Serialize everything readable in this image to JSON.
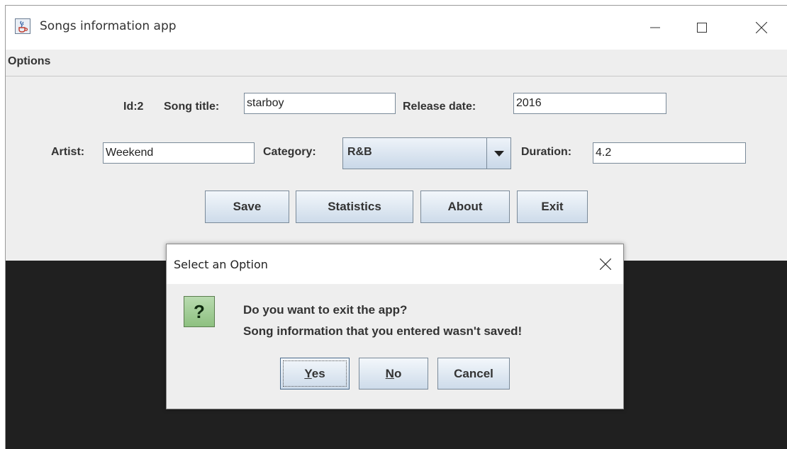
{
  "window": {
    "title": "Songs information app",
    "icon": "java-cup-icon",
    "controls": [
      "minimize-icon",
      "maximize-icon",
      "close-icon"
    ]
  },
  "menu": {
    "options_label": "Options"
  },
  "form": {
    "id_label": "Id:2",
    "song_title_label": "Song title:",
    "song_title_value": "starboy",
    "release_date_label": "Release date:",
    "release_date_value": "2016",
    "artist_label": "Artist:",
    "artist_value": "Weekend",
    "category_label": "Category:",
    "category_value": "R&B",
    "duration_label": "Duration:",
    "duration_value": "4.2"
  },
  "buttons": {
    "save": "Save",
    "statistics": "Statistics",
    "about": "About",
    "exit": "Exit"
  },
  "dialog": {
    "title": "Select an Option",
    "icon": "question-icon",
    "icon_glyph": "?",
    "message_line1": "Do you want to exit the app?",
    "message_line2": "Song information that you entered wasn't saved!",
    "yes_mnemonic": "Y",
    "yes_rest": "es",
    "no_mnemonic": "N",
    "no_rest": "o",
    "cancel": "Cancel"
  },
  "colors": {
    "window_bg": "#eeeeee",
    "button_gradient_top": "#f3f7fb",
    "button_gradient_bottom": "#cddbea",
    "dark_area": "#202020",
    "question_icon": "#8dc080"
  }
}
